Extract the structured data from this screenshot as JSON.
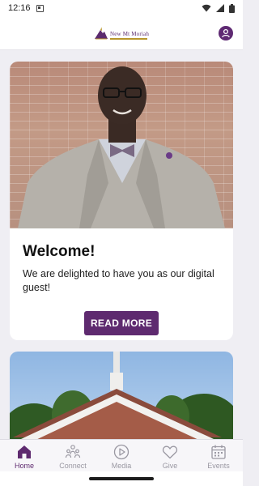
{
  "status_bar": {
    "time": "12:16"
  },
  "header": {
    "logo_text_top": "New Mt Moriah",
    "logo_text_bottom": ""
  },
  "welcome_card": {
    "title": "Welcome!",
    "text": "We are delighted to have you as our digital guest!",
    "button_label": "READ MORE"
  },
  "tabs": [
    {
      "label": "Home",
      "icon": "home-icon",
      "active": true
    },
    {
      "label": "Connect",
      "icon": "people-icon",
      "active": false
    },
    {
      "label": "Media",
      "icon": "play-icon",
      "active": false
    },
    {
      "label": "Give",
      "icon": "heart-icon",
      "active": false
    },
    {
      "label": "Events",
      "icon": "calendar-icon",
      "active": false
    }
  ],
  "colors": {
    "accent": "#5e2a6f",
    "tab_inactive": "#9a98a2",
    "background": "#efeef3"
  }
}
